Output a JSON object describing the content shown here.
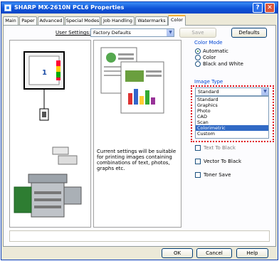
{
  "window": {
    "title": "SHARP MX-2610N PCL6 Properties"
  },
  "titlebar": {
    "help": "?",
    "close": "✕"
  },
  "tabs": [
    "Main",
    "Paper",
    "Advanced",
    "Special Modes",
    "Job Handling",
    "Watermarks",
    "Color"
  ],
  "user_settings": {
    "label": "User Settings:",
    "value": "Factory Defaults",
    "save": "Save",
    "defaults": "Defaults"
  },
  "preview": {
    "page_number": "1"
  },
  "description": "Current settings will be suitable for printing images containing combinations of text, photos, graphs etc.",
  "color_mode": {
    "label": "Color Mode",
    "options": [
      "Automatic",
      "Color",
      "Black and White"
    ],
    "selected": "Automatic"
  },
  "image_type": {
    "label": "Image Type",
    "value": "Standard",
    "options": [
      "Standard",
      "Graphics",
      "Photo",
      "CAD",
      "Scan",
      "Colorimetric",
      "Custom"
    ],
    "highlighted": "Colorimetric"
  },
  "checkboxes": [
    "Text To Black",
    "Vector To Black",
    "Toner Save"
  ],
  "footer": {
    "ok": "OK",
    "cancel": "Cancel",
    "help": "Help"
  },
  "colors": {
    "title_bar": "#0f53d8",
    "highlight": "#316ac5",
    "annotation": "#e0101a"
  }
}
